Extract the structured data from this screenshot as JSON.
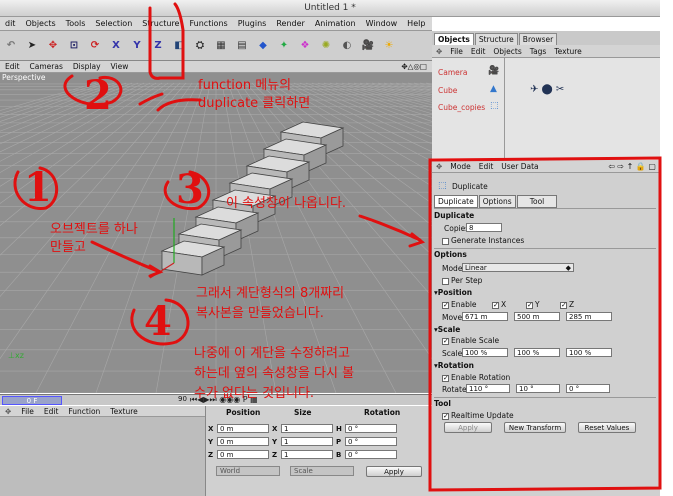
{
  "window": {
    "title": "Untitled 1 *"
  },
  "menubar": {
    "items": [
      "dit",
      "Objects",
      "Tools",
      "Selection",
      "Structure",
      "Functions",
      "Plugins",
      "Render",
      "Animation",
      "Window",
      "Help"
    ]
  },
  "toolbar": {
    "axis_x": "X",
    "axis_y": "Y",
    "axis_z": "Z"
  },
  "viewport": {
    "menu": [
      "Edit",
      "Cameras",
      "Display",
      "View"
    ],
    "label": "Perspective",
    "icons": "✥△◎□",
    "steps": 8
  },
  "timeline": {
    "frame": "0 F",
    "end_frame": "90"
  },
  "materials": {
    "menu": [
      "File",
      "Edit",
      "Function",
      "Texture"
    ]
  },
  "coordinates": {
    "headers": {
      "position": "Position",
      "size": "Size",
      "rotation": "Rotation"
    },
    "rows": [
      {
        "axis": "X",
        "pos": "0 m",
        "size_axis": "X",
        "size": "1",
        "rot_axis": "H",
        "rot": "0 °"
      },
      {
        "axis": "Y",
        "pos": "0 m",
        "size_axis": "Y",
        "size": "1",
        "rot_axis": "P",
        "rot": "0 °"
      },
      {
        "axis": "Z",
        "pos": "0 m",
        "size_axis": "Z",
        "size": "1",
        "rot_axis": "B",
        "rot": "0 °"
      }
    ],
    "world": "World",
    "scale": "Scale",
    "apply": "Apply"
  },
  "object_manager": {
    "tabs": [
      "Objects",
      "Structure",
      "Browser"
    ],
    "menu": [
      "File",
      "Edit",
      "Objects",
      "Tags",
      "Texture"
    ],
    "items": [
      "Camera",
      "Cube",
      "Cube_copies"
    ]
  },
  "attributes": {
    "menu": [
      "Mode",
      "Edit",
      "User Data"
    ],
    "object_name": "Duplicate",
    "tabs": [
      "Duplicate",
      "Options",
      "Tool"
    ],
    "section_duplicate": "Duplicate",
    "copies_label": "Copies",
    "copies_value": "8",
    "generate_instances": "Generate Instances",
    "section_options": "Options",
    "mode_label": "Mode",
    "mode_value": "Linear",
    "per_step": "Per Step",
    "section_position": "▾Position",
    "enable_label": "Enable",
    "chk_x": "X",
    "chk_y": "Y",
    "chk_z": "Z",
    "move_label": "Move",
    "move_x": "671 m",
    "move_y": "500 m",
    "move_z": "285 m",
    "section_scale": "▾Scale",
    "enable_scale": "Enable Scale",
    "scale_label": "Scale",
    "scale_x": "100 %",
    "scale_y": "100 %",
    "scale_z": "100 %",
    "section_rotation": "▾Rotation",
    "enable_rotation": "Enable Rotation",
    "rotate_label": "Rotate",
    "rot_x": "110 °",
    "rot_y": "10 °",
    "rot_z": "0 °",
    "section_tool": "Tool",
    "realtime_update": "Realtime Update",
    "apply": "Apply",
    "new_transform": "New Transform",
    "reset_values": "Reset Values"
  },
  "annotations": {
    "num1": "1",
    "num2": "2",
    "num3": "3",
    "num4": "4",
    "note_function_1": "function 메뉴의",
    "note_function_2": "duplicate 클릭하면",
    "note_attr": "이 속성창이 나옵니다.",
    "note_obj_1": "오브젝트를 하나",
    "note_obj_2": "만들고",
    "note_copies_1": "그래서 계단형식의 8개짜리",
    "note_copies_2": "복사본을 만들었습니다.",
    "note_later_1": "나중에 이 계단을 수정하려고",
    "note_later_2": "하는데 옆의 속성창을 다시 볼",
    "note_later_3": "수가 없다는 것입니다."
  },
  "colors": {
    "annotation": "#e01010",
    "viewport": "#8f8f8f",
    "panel": "#d0d0d0"
  }
}
